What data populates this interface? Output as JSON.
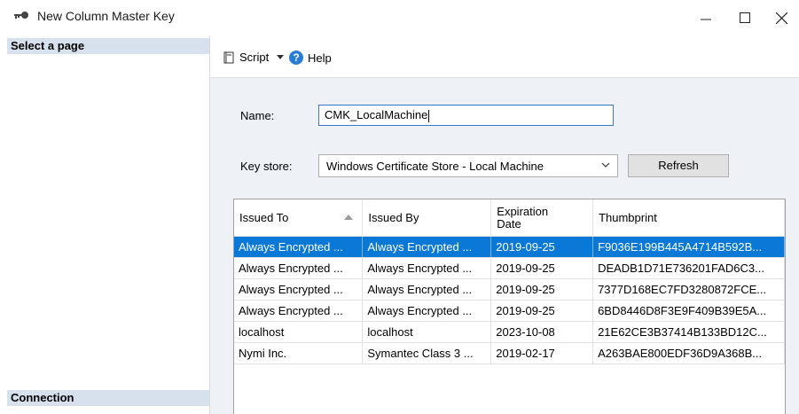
{
  "window": {
    "title": "New Column Master Key",
    "controls": {
      "minimize": "—",
      "maximize": "☐",
      "close": "✕"
    }
  },
  "sidebar": {
    "select_page_label": "Select a page",
    "connection_label": "Connection"
  },
  "toolbar": {
    "script_label": "Script",
    "help_label": "Help",
    "help_icon_glyph": "?"
  },
  "form": {
    "name_label": "Name:",
    "name_value": "CMK_LocalMachine",
    "keystore_label": "Key store:",
    "keystore_value": "Windows Certificate Store - Local Machine",
    "refresh_label": "Refresh"
  },
  "certificates": {
    "columns": [
      "Issued To",
      "Issued By",
      "Expiration Date",
      "Thumbprint"
    ],
    "sorted_column": "Issued To",
    "rows": [
      {
        "issued_to": "Always Encrypted ...",
        "issued_by": "Always Encrypted ...",
        "expiration": "2019-09-25",
        "thumbprint": "F9036E199B445A4714B592B...",
        "selected": true
      },
      {
        "issued_to": "Always Encrypted ...",
        "issued_by": "Always Encrypted ...",
        "expiration": "2019-09-25",
        "thumbprint": "DEADB1D71E736201FAD6C3...",
        "selected": false
      },
      {
        "issued_to": "Always Encrypted ...",
        "issued_by": "Always Encrypted ...",
        "expiration": "2019-09-25",
        "thumbprint": "7377D168EC7FD3280872FCE...",
        "selected": false
      },
      {
        "issued_to": "Always Encrypted ...",
        "issued_by": "Always Encrypted ...",
        "expiration": "2019-09-25",
        "thumbprint": "6BD8446D8F3E9F409B39E5A...",
        "selected": false
      },
      {
        "issued_to": "localhost",
        "issued_by": "localhost",
        "expiration": "2023-10-08",
        "thumbprint": "21E62CE3B37414B133BD12C...",
        "selected": false
      },
      {
        "issued_to": "Nymi Inc.",
        "issued_by": "Symantec Class 3 ...",
        "expiration": "2019-02-17",
        "thumbprint": "A263BAE800EDF36D9A368B...",
        "selected": false
      }
    ]
  },
  "colors": {
    "selection": "#0a78d7",
    "section_header": "#d7e1ee",
    "content_background": "#eef1f6"
  },
  "icons": {
    "title_icon": "key-icon",
    "script_icon": "script-icon",
    "dropdown_icon": "chevron-down-icon",
    "help_icon": "help-icon"
  }
}
